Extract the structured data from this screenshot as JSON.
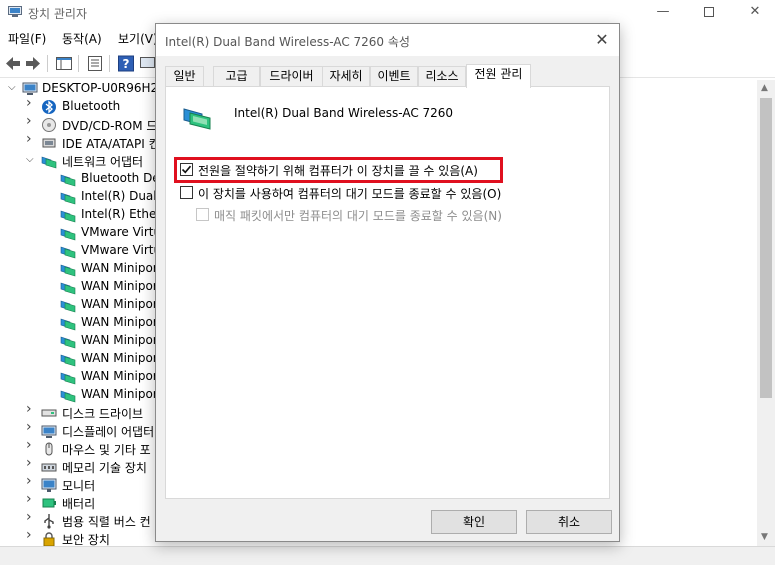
{
  "window": {
    "title": "장치 관리자",
    "minimize_glyph": "—",
    "close_glyph": "✕"
  },
  "menu": {
    "file": "파일(F)",
    "action": "동작(A)",
    "view": "보기(V)"
  },
  "tree": {
    "root": "DESKTOP-U0R96H2",
    "nodes": [
      {
        "label": "Bluetooth",
        "icon": "bluetooth-icon"
      },
      {
        "label": "DVD/CD-ROM 드",
        "icon": "dvd-drive-icon"
      },
      {
        "label": "IDE ATA/ATAPI 컨",
        "icon": "ide-controller-icon"
      },
      {
        "label": "네트워크 어댑터",
        "icon": "network-adapter-icon"
      },
      {
        "label": "Bluetooth Dev",
        "icon": "network-adapter-icon"
      },
      {
        "label": "Intel(R) Dual B",
        "icon": "network-adapter-icon"
      },
      {
        "label": "Intel(R) Ethern",
        "icon": "network-adapter-icon"
      },
      {
        "label": "VMware Virtu",
        "icon": "network-adapter-icon"
      },
      {
        "label": "VMware Virtu",
        "icon": "network-adapter-icon"
      },
      {
        "label": "WAN Minipor",
        "icon": "network-adapter-icon"
      },
      {
        "label": "WAN Minipor",
        "icon": "network-adapter-icon"
      },
      {
        "label": "WAN Minipor",
        "icon": "network-adapter-icon"
      },
      {
        "label": "WAN Minipor",
        "icon": "network-adapter-icon"
      },
      {
        "label": "WAN Minipor",
        "icon": "network-adapter-icon"
      },
      {
        "label": "WAN Minipor",
        "icon": "network-adapter-icon"
      },
      {
        "label": "WAN Minipor",
        "icon": "network-adapter-icon"
      },
      {
        "label": "WAN Minipor",
        "icon": "network-adapter-icon"
      },
      {
        "label": "디스크 드라이브",
        "icon": "disk-drive-icon"
      },
      {
        "label": "디스플레이 어댑터",
        "icon": "display-adapter-icon"
      },
      {
        "label": "마우스 및 기타 포",
        "icon": "mouse-icon"
      },
      {
        "label": "메모리 기술 장치",
        "icon": "memory-device-icon"
      },
      {
        "label": "모니터",
        "icon": "monitor-icon"
      },
      {
        "label": "배터리",
        "icon": "battery-icon"
      },
      {
        "label": "범용 직렬 버스 컨",
        "icon": "usb-controller-icon"
      },
      {
        "label": "보안 장치",
        "icon": "security-device-icon"
      }
    ]
  },
  "dialog": {
    "title": "Intel(R) Dual Band Wireless-AC 7260 속성",
    "close_glyph": "✕",
    "tabs": [
      "일반",
      "고급",
      "드라이버",
      "자세히",
      "이벤트",
      "리소스",
      "전원 관리"
    ],
    "active_tab": "전원 관리",
    "device_name": "Intel(R) Dual Band Wireless-AC 7260",
    "options": [
      {
        "label": "전원을 절약하기 위해 컴퓨터가 이 장치를 끌 수 있음(A)",
        "checked": true,
        "enabled": true
      },
      {
        "label": "이 장치를 사용하여 컴퓨터의 대기 모드를 종료할 수 있음(O)",
        "checked": false,
        "enabled": true
      },
      {
        "label": "매직 패킷에서만 컴퓨터의 대기 모드를 종료할 수 있음(N)",
        "checked": false,
        "enabled": false
      }
    ],
    "ok_label": "확인",
    "cancel_label": "취소"
  },
  "colors": {
    "highlight": "#e0101f",
    "accent": "#0078d7"
  }
}
